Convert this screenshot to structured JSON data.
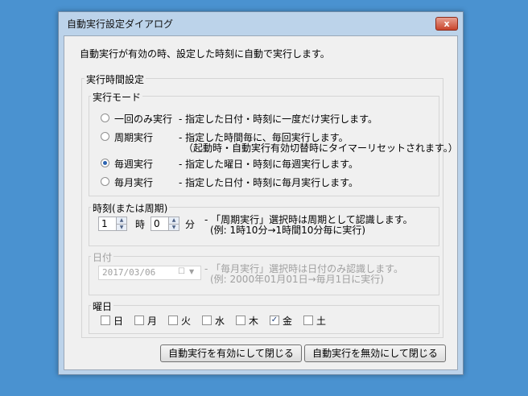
{
  "window": {
    "title": "自動実行設定ダイアログ",
    "close_glyph": "x"
  },
  "description": "自動実行が有効の時、設定した時刻に自動で実行します。",
  "exec_group": {
    "title": "実行時間設定"
  },
  "mode_group": {
    "title": "実行モード",
    "options": [
      {
        "label": "一回のみ実行",
        "desc": "- 指定した日付・時刻に一度だけ実行します。",
        "desc2": "",
        "selected": false
      },
      {
        "label": "周期実行",
        "desc": "- 指定した時間毎に、毎回実行します。",
        "desc2": "（起動時・自動実行有効切替時にタイマーリセットされます。）",
        "selected": false
      },
      {
        "label": "毎週実行",
        "desc": "- 指定した曜日・時刻に毎週実行します。",
        "desc2": "",
        "selected": true
      },
      {
        "label": "毎月実行",
        "desc": "- 指定した日付・時刻に毎月実行します。",
        "desc2": "",
        "selected": false
      }
    ]
  },
  "time_group": {
    "title": "時刻(または周期)",
    "hour_value": "1",
    "hour_unit": "時",
    "minute_value": "0",
    "minute_unit": "分",
    "note1": "- 「周期実行」選択時は周期として認識します。",
    "note2": "(例: 1時10分→1時間10分毎に実行)"
  },
  "date_group": {
    "title": "日付",
    "value": "2017/03/06",
    "note1": "- 「毎月実行」選択時は日付のみ認識します。",
    "note2": "(例: 2000年01月01日→毎月1日に実行)"
  },
  "weekday_group": {
    "title": "曜日",
    "days": [
      {
        "label": "日",
        "checked": false
      },
      {
        "label": "月",
        "checked": false
      },
      {
        "label": "火",
        "checked": false
      },
      {
        "label": "水",
        "checked": false
      },
      {
        "label": "木",
        "checked": false
      },
      {
        "label": "金",
        "checked": true
      },
      {
        "label": "土",
        "checked": false
      }
    ]
  },
  "buttons": {
    "enable_close": "自動実行を有効にして閉じる",
    "disable_close": "自動実行を無効にして閉じる"
  }
}
